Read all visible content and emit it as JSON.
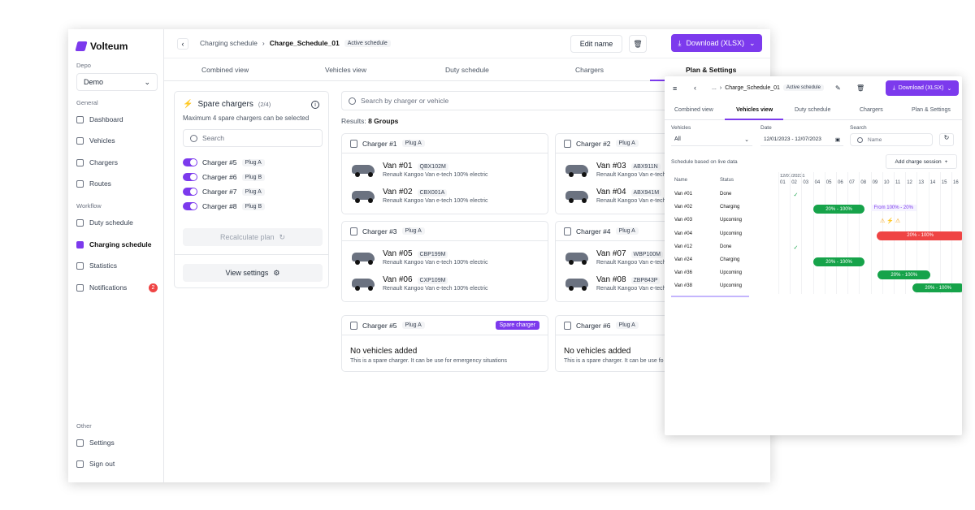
{
  "app": {
    "name": "Volteum"
  },
  "sidebar": {
    "depot_label": "Depo",
    "depot_value": "Demo",
    "general_label": "General",
    "workflow_label": "Workflow",
    "other_label": "Other",
    "general": [
      "Dashboard",
      "Vehicles",
      "Chargers",
      "Routes"
    ],
    "workflow": [
      "Duty schedule",
      "Charging schedule",
      "Statistics",
      "Notifications"
    ],
    "notifications_count": "2",
    "other": [
      "Settings",
      "Sign out"
    ]
  },
  "header": {
    "crumb_parent": "Charging schedule",
    "crumb_current": "Charge_Schedule_01",
    "status": "Active schedule",
    "edit": "Edit name",
    "download": "Download (XLSX)"
  },
  "tabs": [
    "Combined view",
    "Vehicles view",
    "Duty schedule",
    "Chargers",
    "Plan & Settings"
  ],
  "spare": {
    "title": "Spare chargers",
    "count": "(2/4)",
    "subtitle": "Maximum 4 spare chargers can be selected",
    "search": "Search",
    "items": [
      {
        "name": "Charger #5",
        "plug": "Plug A"
      },
      {
        "name": "Charger #6",
        "plug": "Plug B"
      },
      {
        "name": "Charger #7",
        "plug": "Plug A"
      },
      {
        "name": "Charger #8",
        "plug": "Plug B"
      }
    ],
    "recalc": "Recalculate plan",
    "view_settings": "View settings"
  },
  "main": {
    "search": "Search by charger or vehicle",
    "results_label": "Results:",
    "results_value": "8 Groups",
    "model": "Renault Kangoo Van e-tech 100% electric",
    "spare_badge": "Spare charger",
    "empty_title": "No vehicles added",
    "empty_sub": "This is a spare charger. It can be use for emergency situations",
    "empty_sub_cut": "This is a spare charger. It can be use fo",
    "model_cut": "Renault Kangoo Van e-tech",
    "chargers": [
      {
        "name": "Charger #1",
        "plug": "Plug A",
        "vans": [
          {
            "id": "Van #01",
            "plate": "QBX102M"
          },
          {
            "id": "Van #02",
            "plate": "CBX001A"
          }
        ]
      },
      {
        "name": "Charger #2",
        "plug": "Plug A",
        "vans": [
          {
            "id": "Van #03",
            "plate": "ABX911N"
          },
          {
            "id": "Van #04",
            "plate": "ABX941M"
          }
        ]
      },
      {
        "name": "Charger #3",
        "plug": "Plug A",
        "vans": [
          {
            "id": "Van #05",
            "plate": "CBP199M"
          },
          {
            "id": "Van #06",
            "plate": "CXP109M"
          }
        ]
      },
      {
        "name": "Charger #4",
        "plug": "Plug A",
        "vans": [
          {
            "id": "Van #07",
            "plate": "WBP100M"
          },
          {
            "id": "Van #08",
            "plate": "ZBP843P"
          }
        ]
      },
      {
        "name": "Charger #5",
        "plug": "Plug A"
      },
      {
        "name": "Charger #6",
        "plug": "Plug A"
      }
    ]
  },
  "popup": {
    "crumb_dots": "...",
    "crumb": "Charge_Schedule_01",
    "status": "Active schedule",
    "download": "Download (XLSX)",
    "tabs": [
      "Combined view",
      "Vehicles view",
      "Duty schedule",
      "Chargers",
      "Plan & Settings"
    ],
    "vehicles_label": "Vehicles",
    "vehicles_value": "All",
    "date_label": "Date",
    "date_value": "12/01/2023 - 12/07/2023",
    "search_label": "Search",
    "search_placeholder": "Name",
    "live": "Schedule based on live data",
    "add": "Add charge session",
    "col_name": "Name",
    "col_status": "Status",
    "date_header": "12/01/20231",
    "hours": [
      "01",
      "02",
      "03",
      "04",
      "05",
      "06",
      "07",
      "08",
      "09",
      "10",
      "11",
      "12",
      "13",
      "14",
      "15",
      "16"
    ],
    "rows": [
      {
        "name": "Van #01",
        "status": "Done"
      },
      {
        "name": "Van #02",
        "status": "Charging"
      },
      {
        "name": "Van #03",
        "status": "Upcoming"
      },
      {
        "name": "Van #04",
        "status": "Upcoming"
      },
      {
        "name": "Van #12",
        "status": "Done"
      },
      {
        "name": "Van #24",
        "status": "Charging"
      },
      {
        "name": "Van #36",
        "status": "Upcoming"
      },
      {
        "name": "Van #38",
        "status": "Upcoming"
      }
    ],
    "bar_label": "20% - 100%",
    "from_label": "From 100% - 20%"
  }
}
